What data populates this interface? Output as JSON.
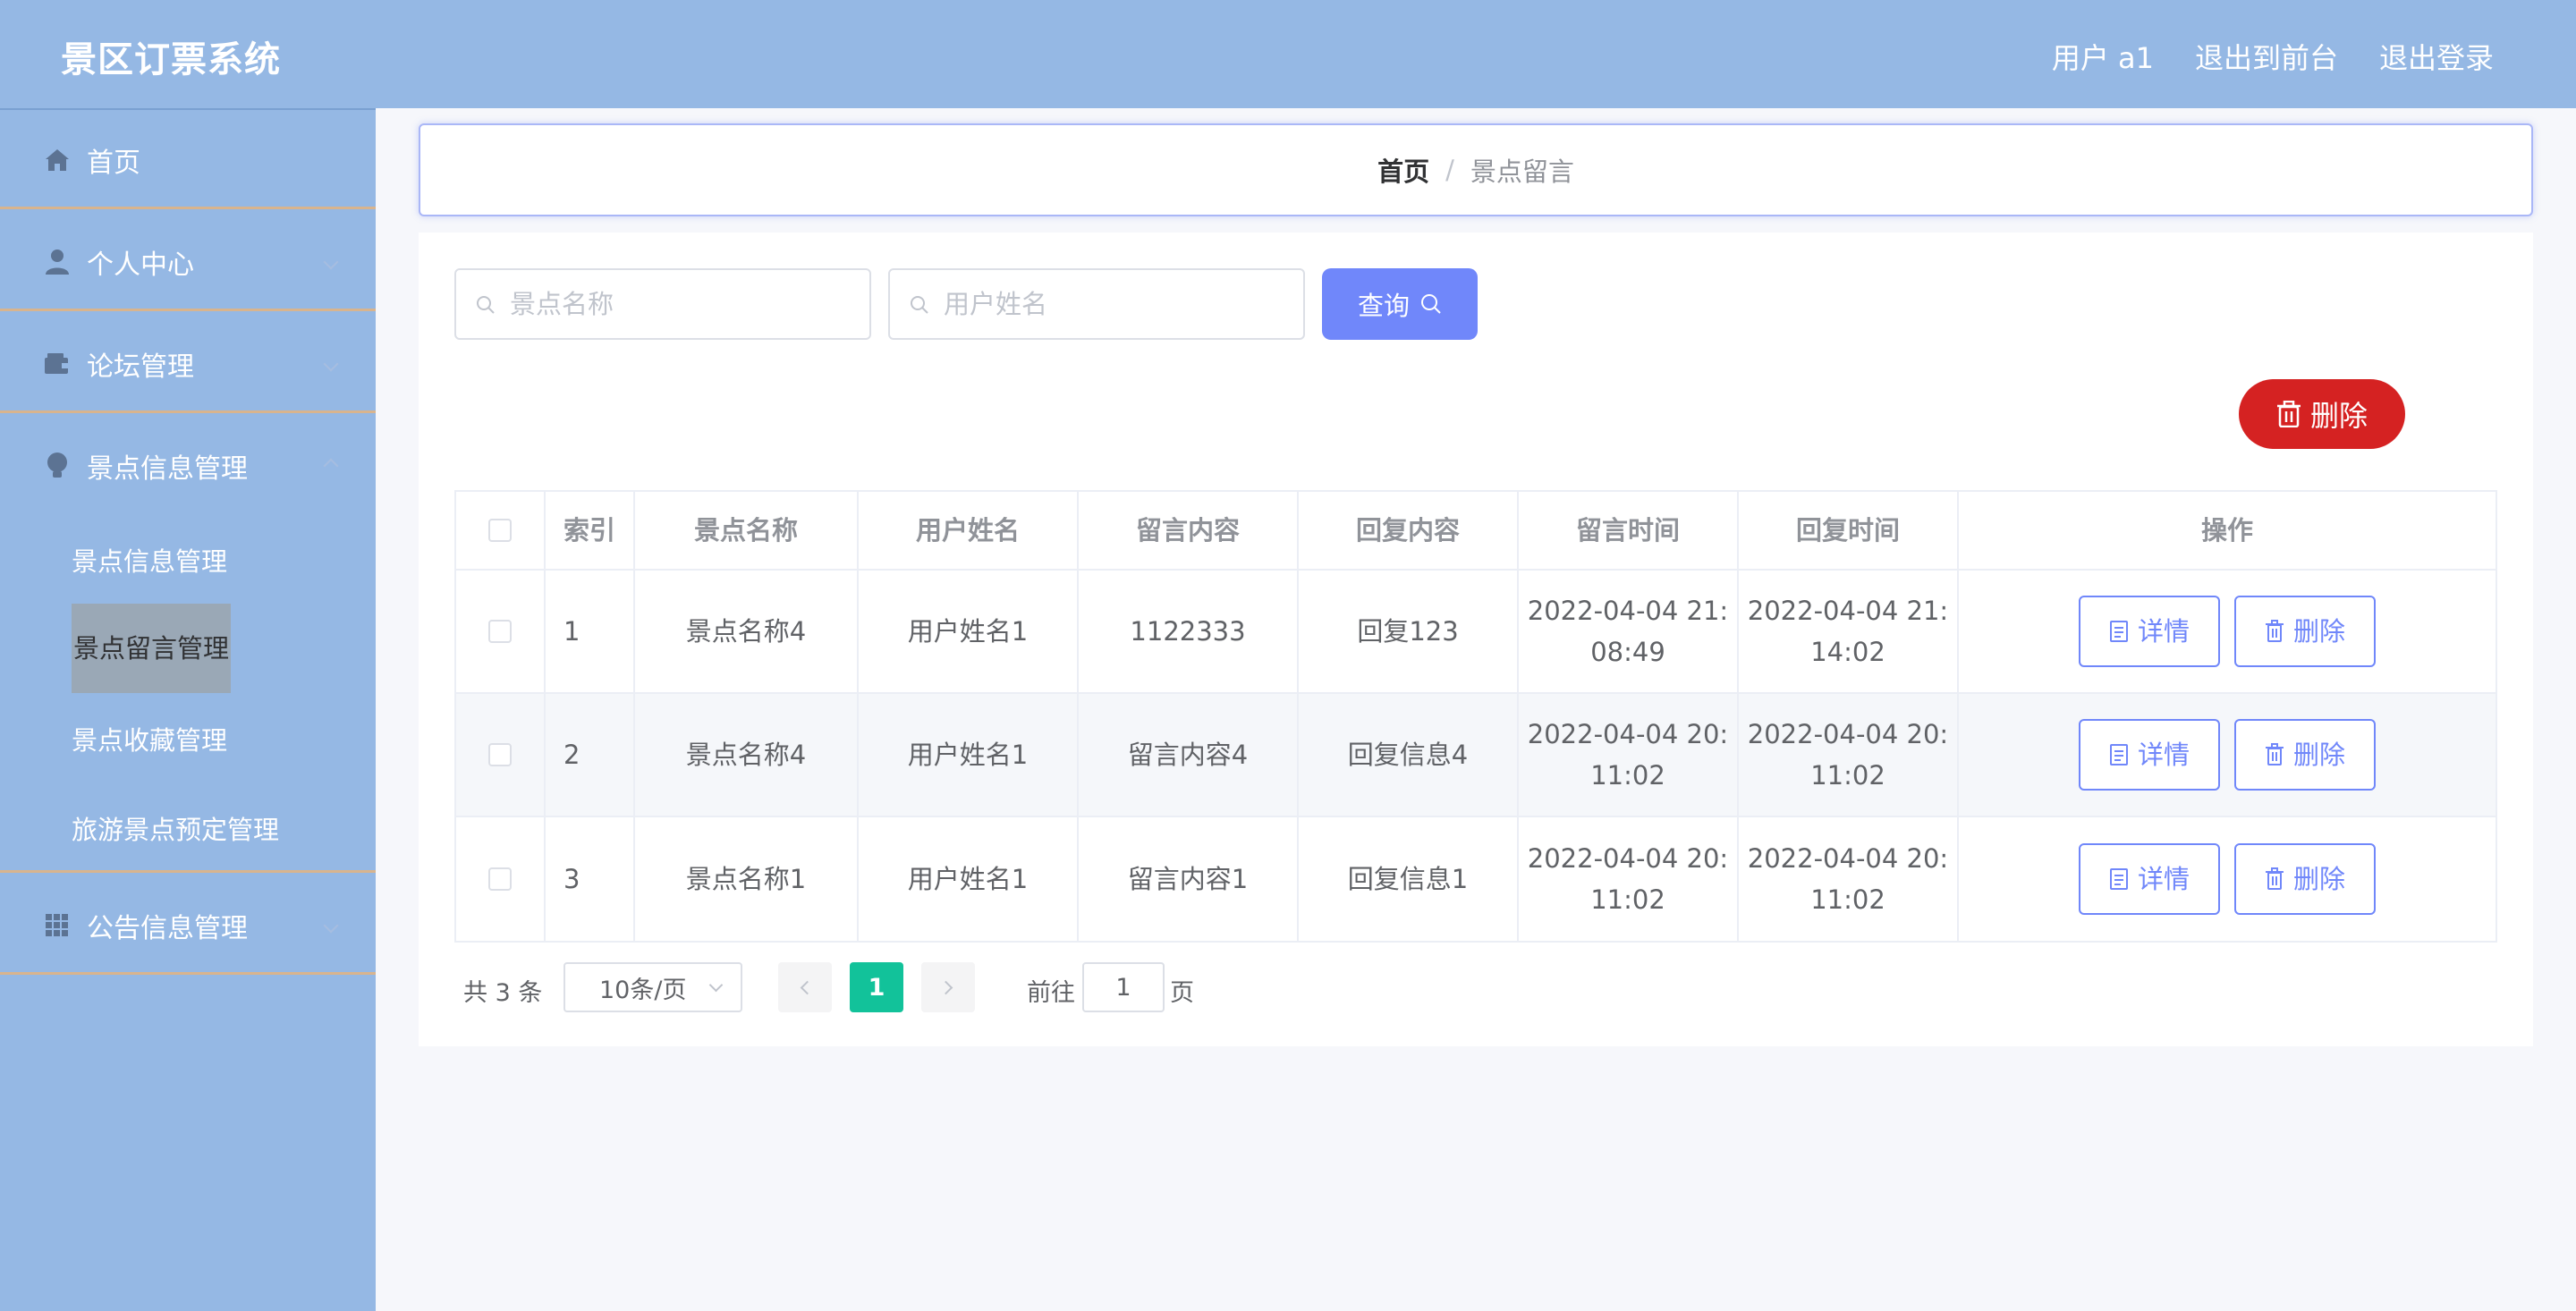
{
  "header": {
    "title": "景区订票系统",
    "user": "用户 a1",
    "front_link": "退出到前台",
    "logout": "退出登录"
  },
  "sidebar": {
    "items": [
      {
        "label": "首页",
        "icon": "home-icon"
      },
      {
        "label": "个人中心",
        "icon": "user-icon"
      },
      {
        "label": "论坛管理",
        "icon": "wallet-icon"
      },
      {
        "label": "景点信息管理",
        "icon": "bulb-icon"
      },
      {
        "label": "公告信息管理",
        "icon": "grid-icon"
      }
    ],
    "subitems": [
      {
        "label": "景点信息管理"
      },
      {
        "label": "景点留言管理"
      },
      {
        "label": "景点收藏管理"
      },
      {
        "label": "旅游景点预定管理"
      }
    ]
  },
  "breadcrumb": {
    "home": "首页",
    "separator": "/",
    "current": "景点留言"
  },
  "search": {
    "name_placeholder": "景点名称",
    "user_placeholder": "用户姓名",
    "query_label": "查询"
  },
  "actions": {
    "delete_label": "删除"
  },
  "table": {
    "headers": [
      "索引",
      "景点名称",
      "用户姓名",
      "留言内容",
      "回复内容",
      "留言时间",
      "回复时间",
      "操作"
    ],
    "rows": [
      {
        "index": "1",
        "name": "景点名称4",
        "user": "用户姓名1",
        "message": "1122333",
        "reply": "回复123",
        "msg_time_1": "2022-04-04 21:",
        "msg_time_2": "08:49",
        "reply_time_1": "2022-04-04 21:",
        "reply_time_2": "14:02"
      },
      {
        "index": "2",
        "name": "景点名称4",
        "user": "用户姓名1",
        "message": "留言内容4",
        "reply": "回复信息4",
        "msg_time_1": "2022-04-04 20:",
        "msg_time_2": "11:02",
        "reply_time_1": "2022-04-04 20:",
        "reply_time_2": "11:02"
      },
      {
        "index": "3",
        "name": "景点名称1",
        "user": "用户姓名1",
        "message": "留言内容1",
        "reply": "回复信息1",
        "msg_time_1": "2022-04-04 20:",
        "msg_time_2": "11:02",
        "reply_time_1": "2022-04-04 20:",
        "reply_time_2": "11:02"
      }
    ],
    "detail_label": "详情",
    "delete_label": "删除"
  },
  "pagination": {
    "total": "共 3 条",
    "page_size": "10条/页",
    "current_page": "1",
    "goto_label": "前往",
    "goto_value": "1",
    "page_suffix": "页"
  },
  "colors": {
    "header_bg": "#95b8e4",
    "primary": "#7087fa",
    "danger": "#d52222",
    "active_page": "#12c29a"
  }
}
